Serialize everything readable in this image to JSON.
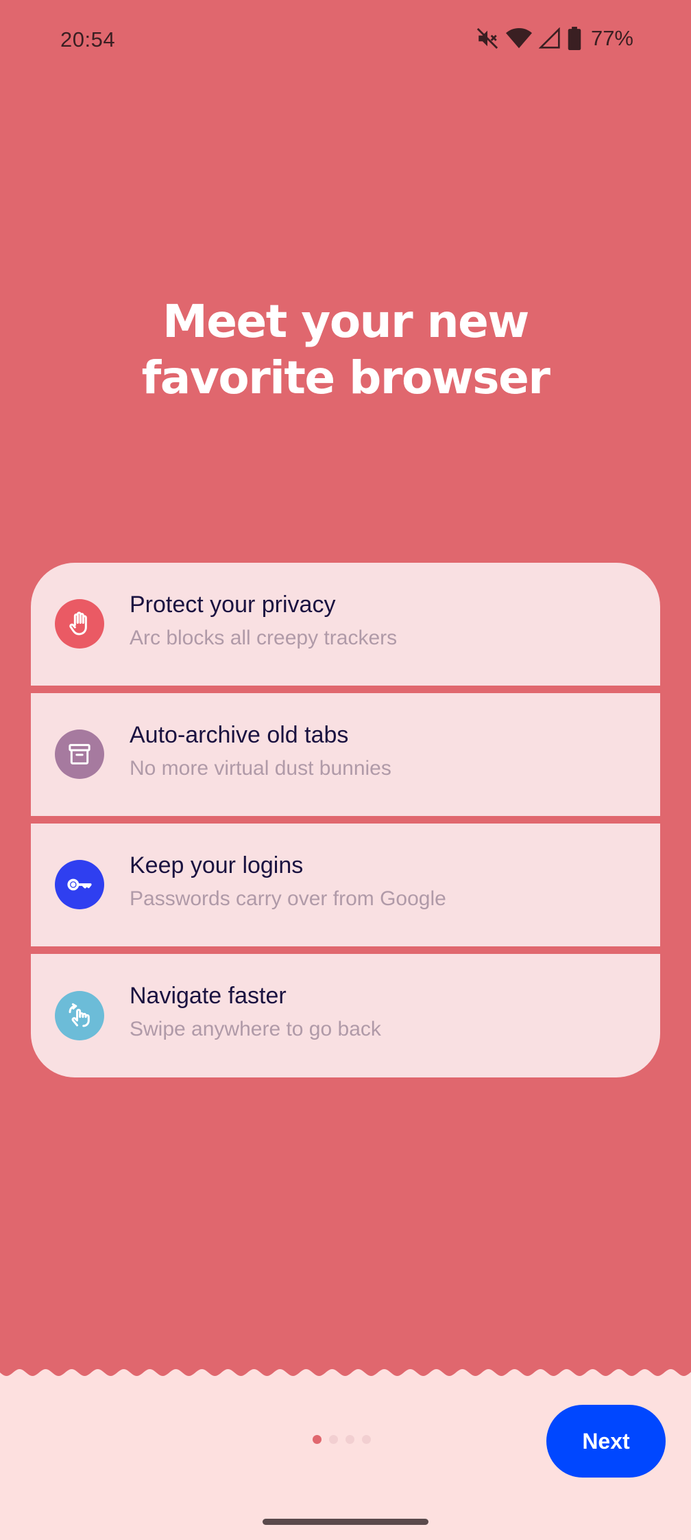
{
  "status_bar": {
    "time": "20:54",
    "battery": "77%",
    "icons": [
      "mute-icon",
      "wifi-icon",
      "cell-signal-icon",
      "battery-icon"
    ]
  },
  "hero": {
    "title_line1": "Meet your new",
    "title_line2": "favorite browser"
  },
  "features": [
    {
      "title": "Protect your privacy",
      "subtitle": "Arc blocks all creepy trackers",
      "icon": "hand-stop-icon",
      "icon_color": "#ea5a64"
    },
    {
      "title": "Auto-archive old tabs",
      "subtitle": "No more virtual dust bunnies",
      "icon": "archive-box-icon",
      "icon_color": "#a67a9f"
    },
    {
      "title": "Keep your logins",
      "subtitle": "Passwords carry over from Google",
      "icon": "key-icon",
      "icon_color": "#2f3ff0"
    },
    {
      "title": "Navigate faster",
      "subtitle": "Swipe anywhere to go back",
      "icon": "swipe-hand-icon",
      "icon_color": "#6cbcd8"
    }
  ],
  "pager": {
    "total": 4,
    "active_index": 0
  },
  "next_button": {
    "label": "Next"
  },
  "colors": {
    "background": "#e0676e",
    "card": "#f9e0e2",
    "bottom": "#fde0df",
    "accent": "#0047ff"
  }
}
